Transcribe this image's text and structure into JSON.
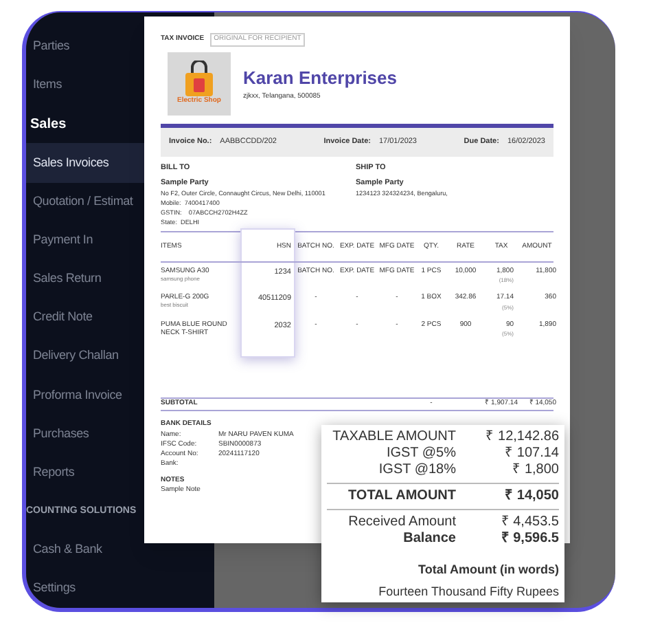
{
  "sidebar": {
    "items": [
      {
        "kind": "item",
        "label": "Parties",
        "selected": false
      },
      {
        "kind": "item",
        "label": "Items",
        "selected": false
      },
      {
        "kind": "header",
        "label": "Sales",
        "selected": false
      },
      {
        "kind": "item",
        "label": "Sales Invoices",
        "selected": true
      },
      {
        "kind": "item",
        "label": "Quotation / Estimat",
        "selected": false
      },
      {
        "kind": "item",
        "label": "Payment In",
        "selected": false
      },
      {
        "kind": "item",
        "label": "Sales Return",
        "selected": false
      },
      {
        "kind": "item",
        "label": "Credit Note",
        "selected": false
      },
      {
        "kind": "item",
        "label": "Delivery Challan",
        "selected": false
      },
      {
        "kind": "item",
        "label": "Proforma Invoice",
        "selected": false
      },
      {
        "kind": "item",
        "label": "Purchases",
        "selected": false
      },
      {
        "kind": "item",
        "label": "Reports",
        "selected": false
      },
      {
        "kind": "section",
        "label": "COUNTING SOLUTIONS",
        "selected": false
      },
      {
        "kind": "item",
        "label": "Cash & Bank",
        "selected": false
      },
      {
        "kind": "item",
        "label": "Settings",
        "selected": false
      }
    ]
  },
  "invoice": {
    "doc_type": "TAX INVOICE",
    "copy_label": "ORIGINAL FOR RECIPIENT",
    "logo_text": "Electric Shop",
    "company": "Karan Enterprises",
    "address": "zjkxx, Telangana, 500085",
    "meta": [
      {
        "label": "Invoice No.:",
        "value": "AABBCCDD/202"
      },
      {
        "label": "Invoice Date:",
        "value": "17/01/2023"
      },
      {
        "label": "Due Date:",
        "value": "16/02/2023"
      }
    ],
    "bill_to": {
      "title": "BILL TO",
      "name": "Sample Party",
      "lines": [
        "No F2, Outer Circle, Connaught Circus, New Delhi, 110001",
        "Mobile:  7400417400",
        "GSTIN:    07ABCCH2702H4ZZ",
        "State:  DELHI"
      ]
    },
    "ship_to": {
      "title": "SHIP TO",
      "name": "Sample Party",
      "lines": [
        "1234123 324324234, Bengaluru,"
      ]
    },
    "table": {
      "columns": [
        "ITEMS",
        "HSN",
        "BATCH NO.",
        "EXP. DATE",
        "MFG DATE",
        "QTY.",
        "RATE",
        "TAX",
        "AMOUNT"
      ],
      "rows": [
        {
          "item": "SAMSUNG A30",
          "description": "samsung phone",
          "hsn": "1234",
          "batch": "BATCH NO.",
          "exp": "EXP. DATE",
          "mfg": "MFG DATE",
          "qty": "1 PCS",
          "rate": "10,000",
          "tax": "1,800",
          "tax_rate": "(18%)",
          "amount": "11,800"
        },
        {
          "item": "PARLE-G 200G",
          "description": "best biscuit",
          "hsn": "40511209",
          "batch": "-",
          "exp": "-",
          "mfg": "-",
          "qty": "1 BOX",
          "rate": "342.86",
          "tax": "17.14",
          "tax_rate": "(5%)",
          "amount": "360"
        },
        {
          "item": "PUMA BLUE ROUND NECK T-SHIRT",
          "hsn": "2032",
          "batch": "-",
          "exp": "-",
          "mfg": "-",
          "qty": "2 PCS",
          "rate": "900",
          "tax": "90",
          "tax_rate": "(5%)",
          "amount": "1,890"
        }
      ]
    },
    "subtotal": {
      "label": "SUBTOTAL",
      "qty": "-",
      "tax": "₹ 1,907.14",
      "amount": "₹ 14,050"
    },
    "bank": {
      "title": "BANK DETAILS",
      "fields": [
        {
          "label": "Name:",
          "value": "Mr NARU PAVEN KUMA"
        },
        {
          "label": "IFSC Code:",
          "value": "SBIN0000873"
        },
        {
          "label": "Account No:",
          "value": "20241117120"
        },
        {
          "label": "Bank:"
        }
      ]
    },
    "notes": {
      "title": "NOTES",
      "text": "Sample Note"
    }
  },
  "totals": {
    "rows": [
      {
        "kind": "plain",
        "label": "TAXABLE AMOUNT",
        "value": "₹ 12,142.86"
      },
      {
        "kind": "plain",
        "label": "IGST @5%",
        "value": "₹ 107.14"
      },
      {
        "kind": "plain",
        "label": "IGST @18%",
        "value": "₹ 1,800"
      },
      {
        "kind": "total",
        "label": "TOTAL AMOUNT",
        "value": "₹ 14,050"
      },
      {
        "kind": "plain",
        "label": "Received Amount",
        "value": "₹ 4,453.5"
      },
      {
        "kind": "strong",
        "label": "Balance",
        "value": "₹ 9,596.5"
      }
    ],
    "words_title": "Total Amount (in words)",
    "words": "Fourteen Thousand Fifty Rupees"
  }
}
